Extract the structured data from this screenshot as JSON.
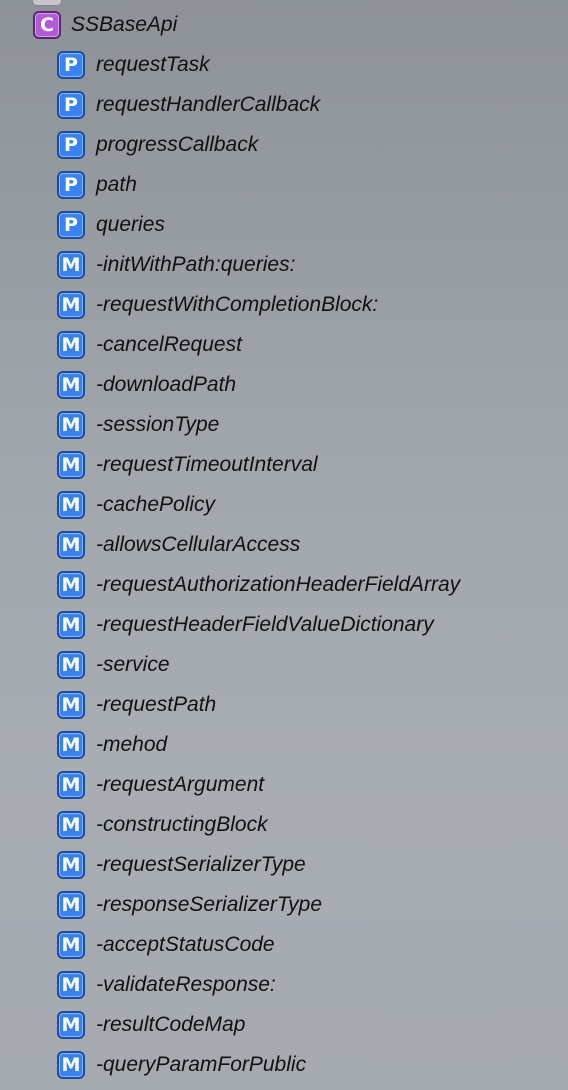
{
  "class_item": {
    "badge": "C",
    "label": "SSBaseApi",
    "icon": "class-badge-icon",
    "badge_color": "#b35ad6"
  },
  "members": [
    {
      "badge": "P",
      "label": "requestTask",
      "icon": "property-badge-icon"
    },
    {
      "badge": "P",
      "label": "requestHandlerCallback",
      "icon": "property-badge-icon"
    },
    {
      "badge": "P",
      "label": "progressCallback",
      "icon": "property-badge-icon"
    },
    {
      "badge": "P",
      "label": "path",
      "icon": "property-badge-icon"
    },
    {
      "badge": "P",
      "label": "queries",
      "icon": "property-badge-icon"
    },
    {
      "badge": "M",
      "label": "-initWithPath:queries:",
      "icon": "method-badge-icon"
    },
    {
      "badge": "M",
      "label": "-requestWithCompletionBlock:",
      "icon": "method-badge-icon"
    },
    {
      "badge": "M",
      "label": "-cancelRequest",
      "icon": "method-badge-icon"
    },
    {
      "badge": "M",
      "label": "-downloadPath",
      "icon": "method-badge-icon"
    },
    {
      "badge": "M",
      "label": "-sessionType",
      "icon": "method-badge-icon"
    },
    {
      "badge": "M",
      "label": "-requestTimeoutInterval",
      "icon": "method-badge-icon"
    },
    {
      "badge": "M",
      "label": "-cachePolicy",
      "icon": "method-badge-icon"
    },
    {
      "badge": "M",
      "label": "-allowsCellularAccess",
      "icon": "method-badge-icon"
    },
    {
      "badge": "M",
      "label": "-requestAuthorizationHeaderFieldArray",
      "icon": "method-badge-icon"
    },
    {
      "badge": "M",
      "label": "-requestHeaderFieldValueDictionary",
      "icon": "method-badge-icon"
    },
    {
      "badge": "M",
      "label": "-service",
      "icon": "method-badge-icon"
    },
    {
      "badge": "M",
      "label": "-requestPath",
      "icon": "method-badge-icon"
    },
    {
      "badge": "M",
      "label": "-mehod",
      "icon": "method-badge-icon"
    },
    {
      "badge": "M",
      "label": "-requestArgument",
      "icon": "method-badge-icon"
    },
    {
      "badge": "M",
      "label": "-constructingBlock",
      "icon": "method-badge-icon"
    },
    {
      "badge": "M",
      "label": "-requestSerializerType",
      "icon": "method-badge-icon"
    },
    {
      "badge": "M",
      "label": "-responseSerializerType",
      "icon": "method-badge-icon"
    },
    {
      "badge": "M",
      "label": "-acceptStatusCode",
      "icon": "method-badge-icon"
    },
    {
      "badge": "M",
      "label": "-validateResponse:",
      "icon": "method-badge-icon"
    },
    {
      "badge": "M",
      "label": "-resultCodeMap",
      "icon": "method-badge-icon"
    },
    {
      "badge": "M",
      "label": "-queryParamForPublic",
      "icon": "method-badge-icon"
    }
  ],
  "colors": {
    "property_badge": "#3a83ee",
    "method_badge": "#3a83ee",
    "background": "#a2a7ae"
  }
}
